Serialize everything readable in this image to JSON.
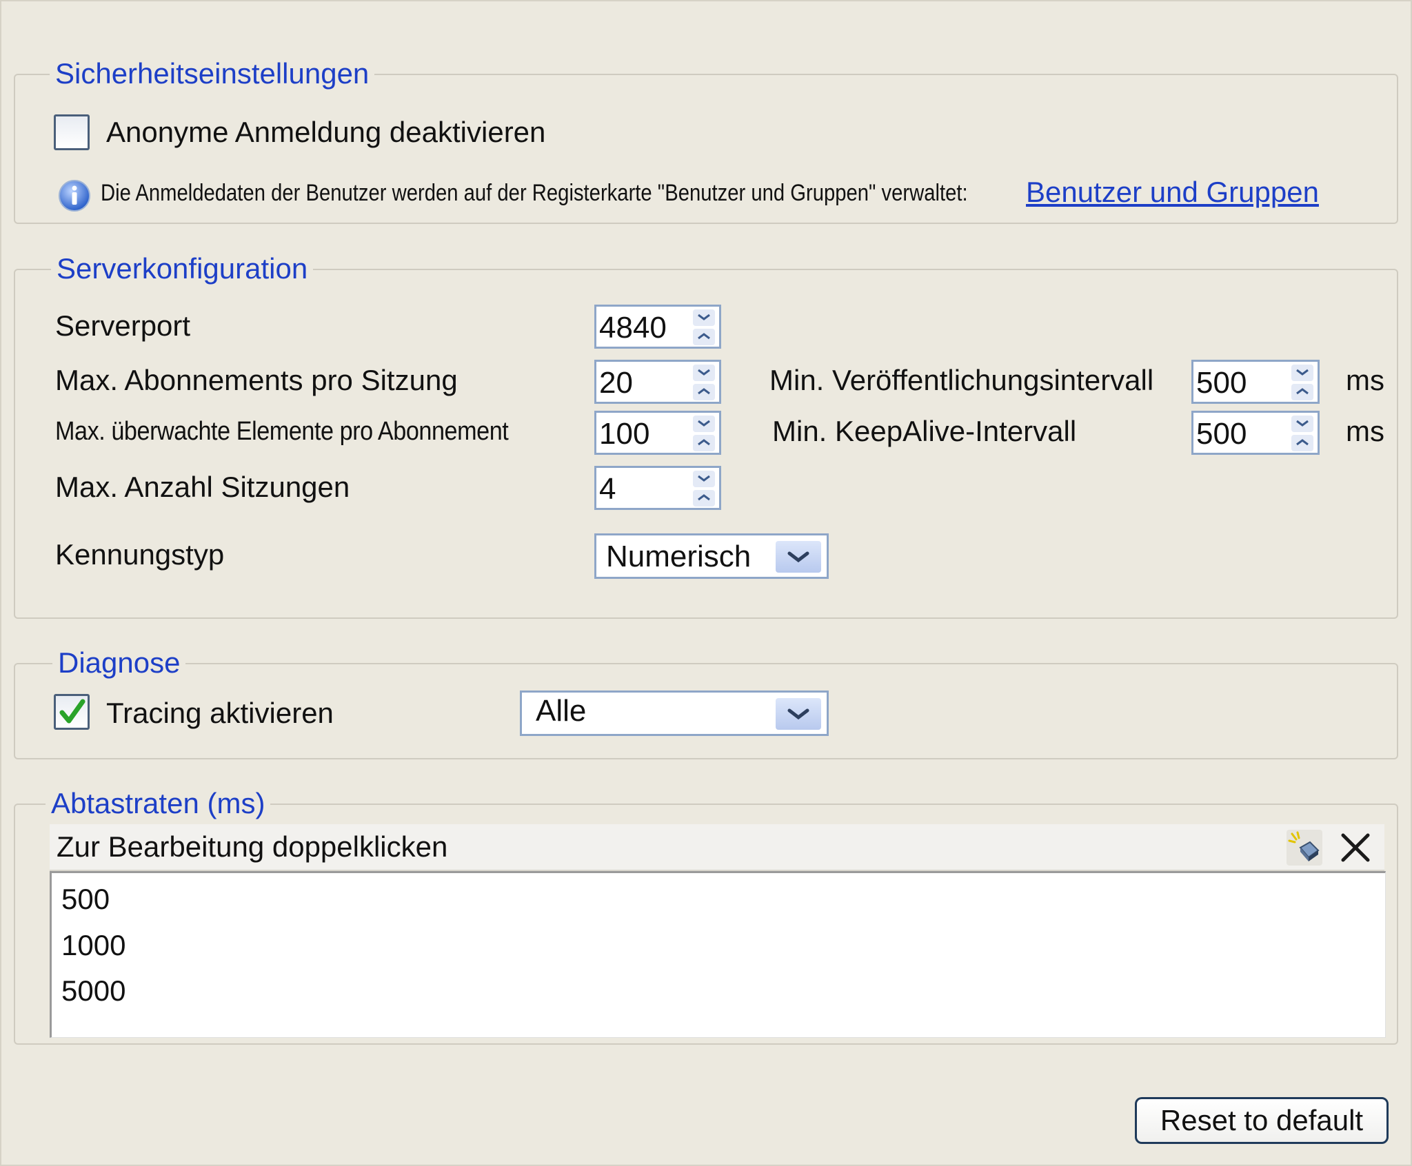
{
  "security": {
    "legend": "Sicherheitseinstellungen",
    "anon_label": "Anonyme Anmeldung deaktivieren",
    "anon_checked": false,
    "info_text": "Die Anmeldedaten der Benutzer werden auf der Registerkarte \"Benutzer und Gruppen\" verwaltet:",
    "link_label": "Benutzer und Gruppen"
  },
  "server": {
    "legend": "Serverkonfiguration",
    "port_label": "Serverport",
    "port_value": "4840",
    "max_subs_label": "Max. Abonnements pro Sitzung",
    "max_subs_value": "20",
    "max_items_label": "Max. überwachte Elemente pro Abonnement",
    "max_items_value": "100",
    "max_sessions_label": "Max. Anzahl Sitzungen",
    "max_sessions_value": "4",
    "id_type_label": "Kennungstyp",
    "id_type_value": "Numerisch",
    "min_publish_label": "Min. Veröffentlichungsintervall",
    "min_publish_value": "500",
    "min_keepalive_label": "Min. KeepAlive-Intervall",
    "min_keepalive_value": "500",
    "unit": "ms"
  },
  "diagnosis": {
    "legend": "Diagnose",
    "tracing_label": "Tracing aktivieren",
    "tracing_checked": true,
    "tracing_level": "Alle"
  },
  "sampling": {
    "legend": "Abtastraten (ms)",
    "header": "Zur Bearbeitung doppelklicken",
    "items": [
      "500",
      "1000",
      "5000"
    ]
  },
  "footer": {
    "reset_label": "Reset to default"
  },
  "colors": {
    "background": "#ece9df",
    "legend": "#1d3fc7",
    "link": "#1d3fc7",
    "check": "#2aa32a",
    "field_border": "#8ea6c8"
  }
}
